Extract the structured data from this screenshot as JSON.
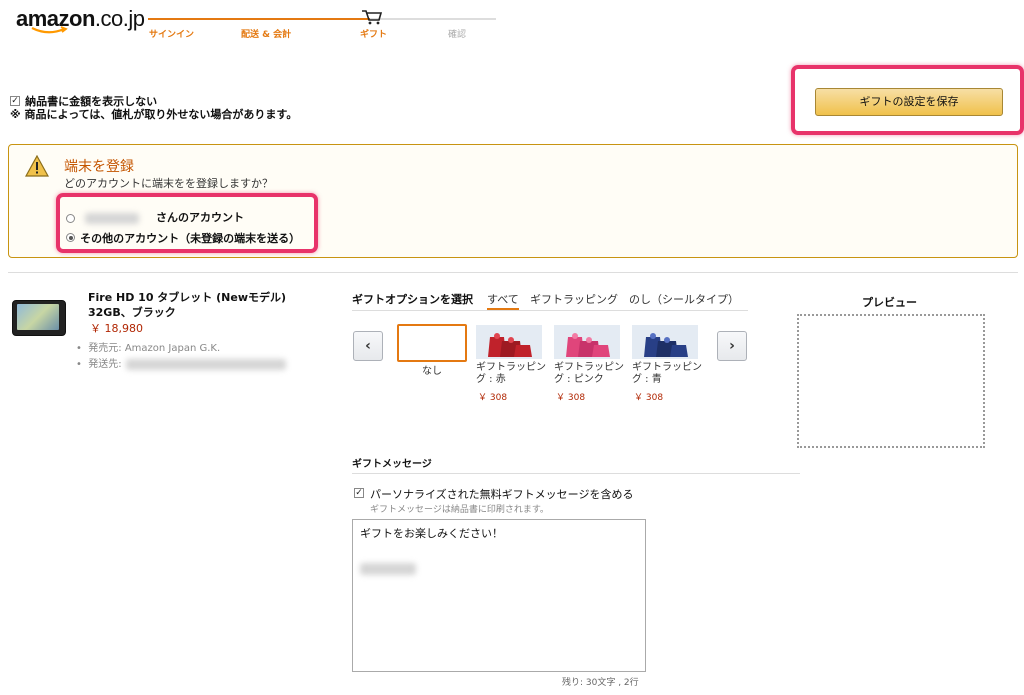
{
  "header": {
    "logo_main": "amazon",
    "logo_tld": ".co.jp",
    "steps": [
      {
        "label": "サインイン",
        "state": "done"
      },
      {
        "label": "配送 & 会計",
        "state": "done"
      },
      {
        "label": "ギフト",
        "state": "current"
      },
      {
        "label": "確認",
        "state": "pending"
      }
    ]
  },
  "gift_settings": {
    "hide_amount_label": "納品書に金額を表示しない",
    "hide_amount_checked": true,
    "note": "※ 商品によっては、値札が取り外せない場合があります。",
    "save_button": "ギフトの設定を保存"
  },
  "register_device": {
    "title": "端末を登録",
    "question": "どのアカウントに端末をを登録しますか？",
    "option_own_suffix": "さんのアカウント",
    "option_other": "その他のアカウント（未登録の端末を送る）",
    "selected": "other"
  },
  "product": {
    "name_line1": "Fire HD 10 タブレット (Newモデル)",
    "name_line2": "32GB、ブラック",
    "price": "￥ 18,980",
    "seller": "発売元: Amazon Japan G.K.",
    "ship_to_label": "発送先:"
  },
  "gift_options": {
    "label": "ギフトオプションを選択",
    "tabs": [
      "すべて",
      "ギフトラッピング",
      "のし（シールタイプ）"
    ],
    "active_tab": "すべて",
    "prev_icon": "chevron-left-icon",
    "next_icon": "chevron-right-icon",
    "none_label": "なし",
    "items": [
      {
        "label": "ギフトラッピング : 赤",
        "price": "￥ 308",
        "color": "#c0222b"
      },
      {
        "label": "ギフトラッピング : ピンク",
        "price": "￥ 308",
        "color": "#e0457b"
      },
      {
        "label": "ギフトラッピング : 青",
        "price": "￥ 308",
        "color": "#283f86"
      }
    ]
  },
  "preview": {
    "title": "プレビュー"
  },
  "gift_message": {
    "title": "ギフトメッセージ",
    "include_label": "パーソナライズされた無料ギフトメッセージを含める",
    "include_checked": true,
    "note": "ギフトメッセージは納品書に印刷されます。",
    "message": "ギフトをお楽しみください！",
    "remaining": "残り: 30文字 , 2行"
  },
  "colors": {
    "accent": "#e47911",
    "highlight": "#e8336a",
    "price": "#b12704"
  }
}
